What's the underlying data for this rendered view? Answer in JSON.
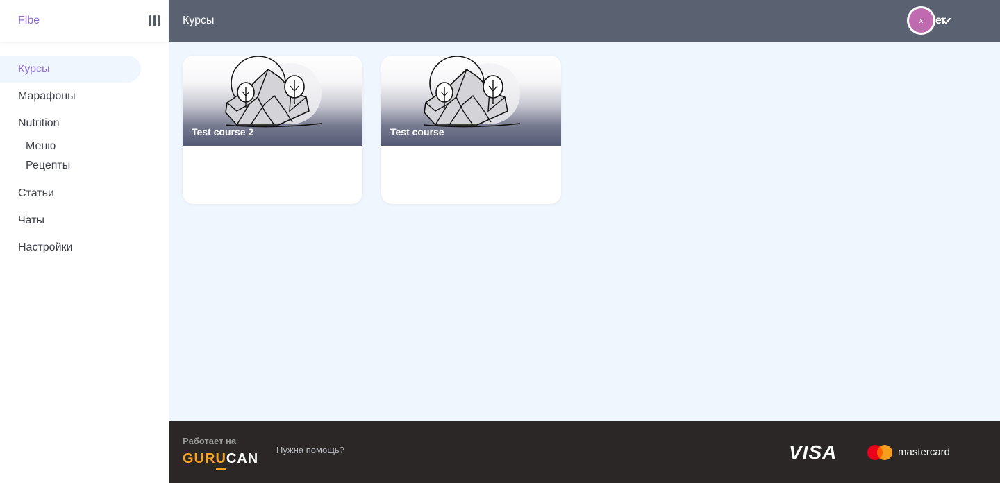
{
  "app": {
    "brand": "Fibe"
  },
  "sidebar": {
    "items": [
      {
        "label": "Курсы",
        "active": true
      },
      {
        "label": "Марафоны"
      },
      {
        "label": "Nutrition"
      },
      {
        "label": "Статьи"
      },
      {
        "label": "Чаты"
      },
      {
        "label": "Настройки"
      }
    ],
    "nutrition_sub": [
      {
        "label": "Меню"
      },
      {
        "label": "Рецепты"
      }
    ]
  },
  "header": {
    "title": "Курсы",
    "username": "xomer",
    "avatar_initial": "x"
  },
  "courses": [
    {
      "title": "Test course 2"
    },
    {
      "title": "Test course"
    }
  ],
  "footer": {
    "powered_by": "Работает на",
    "logo_part1": "GUR",
    "logo_part2": "U",
    "logo_part3": "CAN",
    "help": "Нужна помощь?",
    "visa": "VISA",
    "mastercard": "mastercard"
  },
  "colors": {
    "accent": "#8f6fd3",
    "header_bg": "#5a6170",
    "content_bg": "#eff6fe",
    "footer_bg": "#2b2727",
    "avatar": "#c06bb0",
    "gurucan_orange": "#f4a421"
  },
  "icons": [
    "hamburger-icon",
    "chevron-down-icon",
    "placeholder-landscape-icon",
    "mastercard-icon"
  ]
}
